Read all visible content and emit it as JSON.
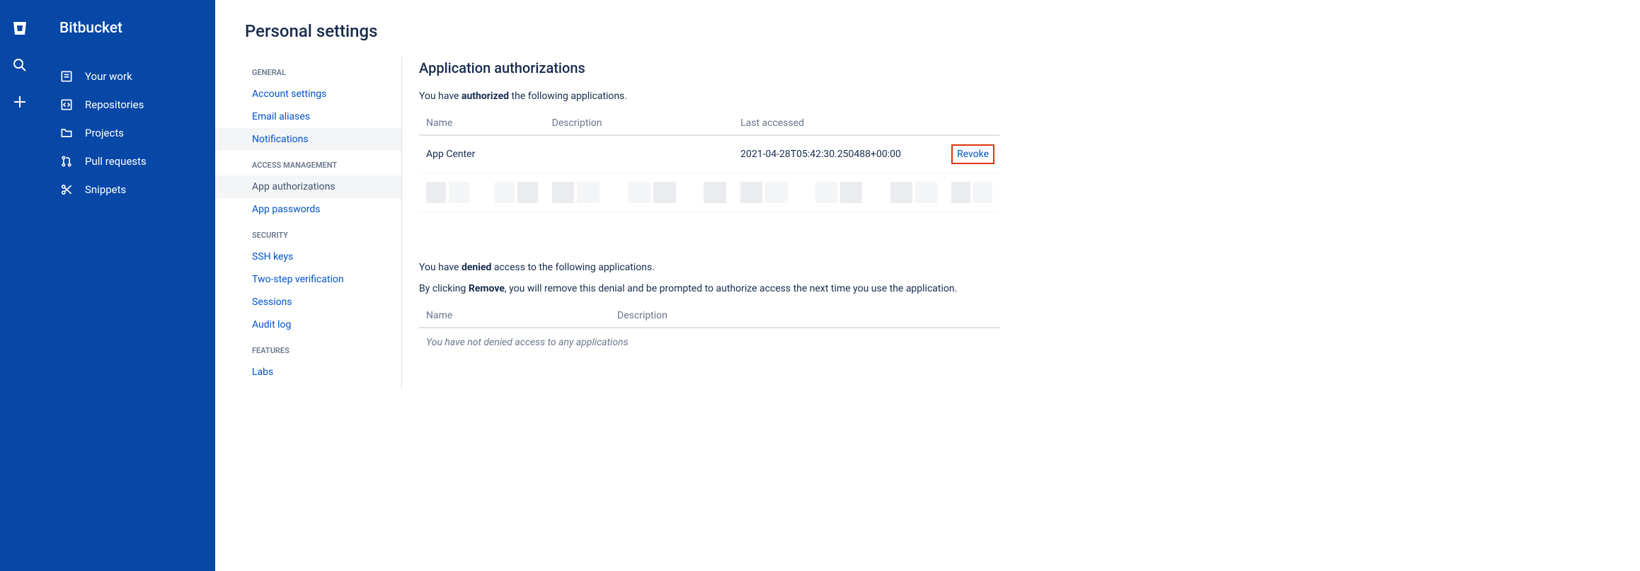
{
  "product": {
    "name": "Bitbucket"
  },
  "global_nav": [
    {
      "name": "your-work",
      "label": "Your work",
      "icon": "board-icon"
    },
    {
      "name": "repositories",
      "label": "Repositories",
      "icon": "code-icon"
    },
    {
      "name": "projects",
      "label": "Projects",
      "icon": "folder-icon"
    },
    {
      "name": "pull-requests",
      "label": "Pull requests",
      "icon": "pullrequest-icon"
    },
    {
      "name": "snippets",
      "label": "Snippets",
      "icon": "snip-icon"
    }
  ],
  "settings": {
    "title": "Personal settings",
    "groups": [
      {
        "heading": "GENERAL",
        "items": [
          {
            "label": "Account settings"
          },
          {
            "label": "Email aliases"
          },
          {
            "label": "Notifications",
            "hovered": true
          }
        ]
      },
      {
        "heading": "ACCESS MANAGEMENT",
        "items": [
          {
            "label": "App authorizations",
            "active": true
          },
          {
            "label": "App passwords"
          }
        ]
      },
      {
        "heading": "SECURITY",
        "items": [
          {
            "label": "SSH keys"
          },
          {
            "label": "Two-step verification"
          },
          {
            "label": "Sessions"
          },
          {
            "label": "Audit log"
          }
        ]
      },
      {
        "heading": "FEATURES",
        "items": [
          {
            "label": "Labs"
          }
        ]
      }
    ]
  },
  "content": {
    "section_title": "Application authorizations",
    "authorized_intro_pre": "You have ",
    "authorized_intro_strong": "authorized",
    "authorized_intro_post": " the following applications.",
    "auth_headers": {
      "name": "Name",
      "description": "Description",
      "last_accessed": "Last accessed"
    },
    "auth_rows": [
      {
        "name": "App Center",
        "description": "",
        "last_accessed": "2021-04-28T05:42:30.250488+00:00",
        "action": "Revoke"
      }
    ],
    "denied_intro_pre": "You have ",
    "denied_intro_strong": "denied",
    "denied_intro_post": " access to the following applications.",
    "remove_intro_pre": "By clicking ",
    "remove_intro_strong": "Remove",
    "remove_intro_post": ", you will remove this denial and be prompted to authorize access the next time you use the application.",
    "denied_headers": {
      "name": "Name",
      "description": "Description"
    },
    "denied_empty": "You have not denied access to any applications"
  }
}
